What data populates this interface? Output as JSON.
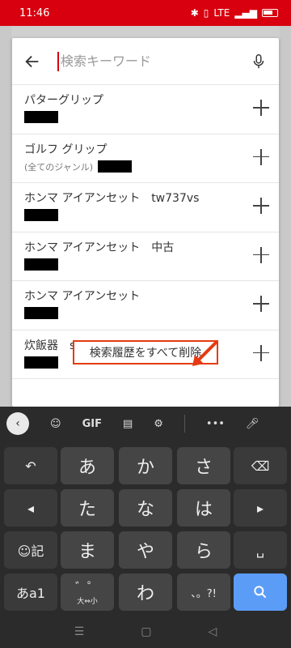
{
  "status": {
    "time": "11:46",
    "signal": "LTE",
    "battery_icon": "battery-icon"
  },
  "search": {
    "placeholder": "検索キーワード"
  },
  "suggestions": [
    {
      "title": "パターグリップ",
      "sub": ""
    },
    {
      "title": "ゴルフ グリップ",
      "sub": "(全てのジャンル)"
    },
    {
      "title": "ホンマ アイアンセット　tw737vs",
      "sub": ""
    },
    {
      "title": "ホンマ アイアンセット　中古",
      "sub": ""
    },
    {
      "title": "ホンマ アイアンセット",
      "sub": ""
    },
    {
      "title": "炊飯器　srfe101",
      "sub": ""
    }
  ],
  "clear_history": "検索履歴をすべて削除",
  "keyboard": {
    "toolbar": {
      "gif": "GIF",
      "more": "•••"
    },
    "row1": [
      "あ",
      "か",
      "さ"
    ],
    "row2": [
      "た",
      "な",
      "は"
    ],
    "row3": [
      "ま",
      "や",
      "ら"
    ],
    "row4_mid": [
      "わ"
    ],
    "emoji_label": "☺記",
    "mode_label": "あa1",
    "dakuten_label": "゛゜",
    "dakuten_sub": "大⇔小",
    "punct_label": "、。?!"
  },
  "colors": {
    "brand": "#d8000f",
    "accent_outline": "#e53b12",
    "enter": "#5b9cf7"
  }
}
